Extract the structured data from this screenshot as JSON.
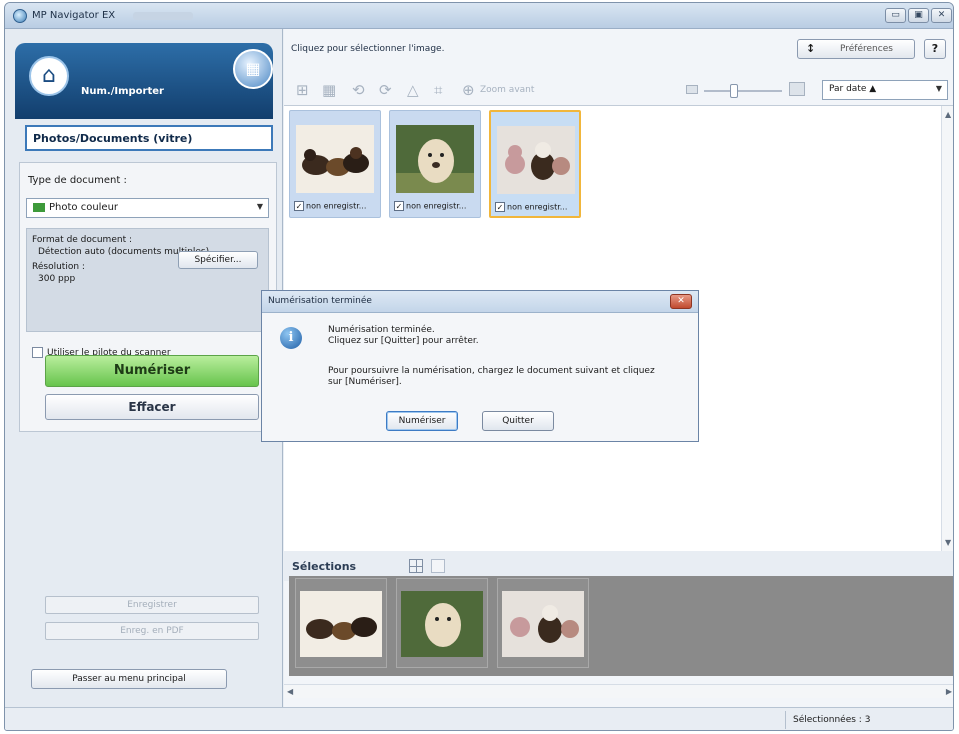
{
  "window": {
    "title": "MP Navigator EX",
    "minimize_glyph": "▭",
    "maximize_glyph": "▣",
    "close_glyph": "✕"
  },
  "left_panel": {
    "mode_label": "Num./Importer",
    "scanner_icon": "scanner-icon",
    "mode_switch_icon": "mode-switch-icon",
    "source": "Photos/Documents (vitre)",
    "doc_type_label": "Type de document :",
    "doc_type_value": "Photo couleur",
    "format_label": "Format de document :",
    "format_value": "Détection auto (documents multiples)",
    "resolution_label": "Résolution :",
    "resolution_value": "300 ppp",
    "specify_button": "Spécifier...",
    "use_driver_label": "Utiliser le pilote du scanner",
    "scan_button": "Numériser",
    "clear_button": "Effacer",
    "save_button": "Enregistrer",
    "save_pdf_button": "Enreg. en PDF",
    "main_menu_button": "Passer au menu principal"
  },
  "right_panel": {
    "hint": "Cliquez pour sélectionner l'image.",
    "preferences_button": "Préférences",
    "preferences_icon_glyph": "↕",
    "help_button": "?",
    "zoom_label": "Zoom avant",
    "sort_value": "Par date ▲",
    "thumbnails": [
      {
        "caption": "non enregistr...",
        "selected": false
      },
      {
        "caption": "non enregistr...",
        "selected": false
      },
      {
        "caption": "non enregistr...",
        "selected": true
      }
    ],
    "selections_label": "Sélections",
    "status": "Sélectionnées : 3"
  },
  "dialog": {
    "title": "Numérisation terminée",
    "line1": "Numérisation terminée.",
    "line2": "Cliquez sur [Quitter] pour arrêter.",
    "line3": "Pour poursuivre la numérisation, chargez le document suivant et cliquez",
    "line4": "sur [Numériser].",
    "scan_button": "Numériser",
    "quit_button": "Quitter"
  },
  "colors": {
    "accent": "#2d6ea8",
    "scan_button": "#67c44d",
    "selected_border": "#f1b63b"
  }
}
